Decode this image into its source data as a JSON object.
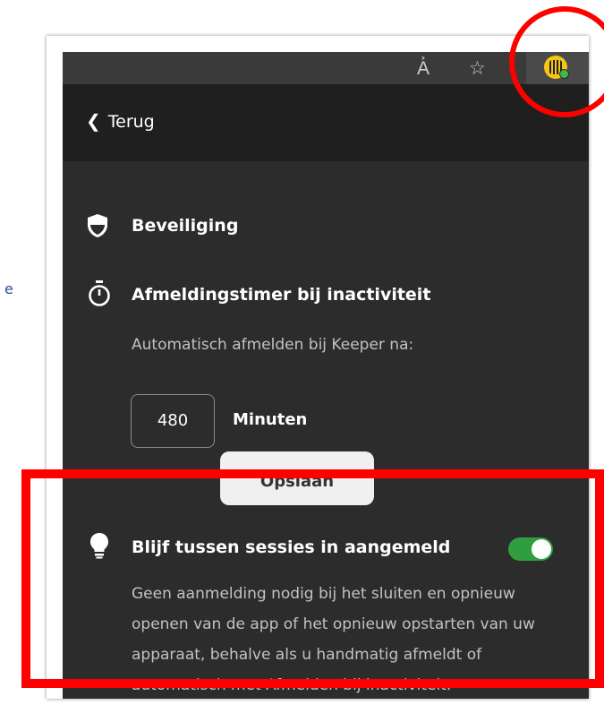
{
  "stray_text": "e",
  "toolbar": {
    "reader_icon": "A͐",
    "favorite_icon": "☆",
    "extension": "keeper-extension-icon",
    "status_color": "#3fb94e"
  },
  "header": {
    "back_label": "Terug"
  },
  "security": {
    "title": "Beveiliging"
  },
  "logout_timer": {
    "title": "Afmeldingstimer bij inactiviteit",
    "description": "Automatisch afmelden bij Keeper na:",
    "minutes_value": "480",
    "minutes_unit": "Minuten",
    "save_label": "Opslaan"
  },
  "stay_logged_in": {
    "title": "Blijf tussen sessies in aangemeld",
    "enabled": true,
    "description": "Geen aanmelding nodig bij het sluiten en opnieuw openen van de app of het opnieuw opstarten van uw apparaat, behalve als u handmatig afmeldt of automatisch met Afmelden bij inactiviteit."
  },
  "colors": {
    "panel_bg": "#2c2c2c",
    "header_bg": "#1f1f1f",
    "toggle_on": "#2f9e3f",
    "annotation_red": "#ff0000",
    "keeper_yellow": "#f5c518"
  }
}
